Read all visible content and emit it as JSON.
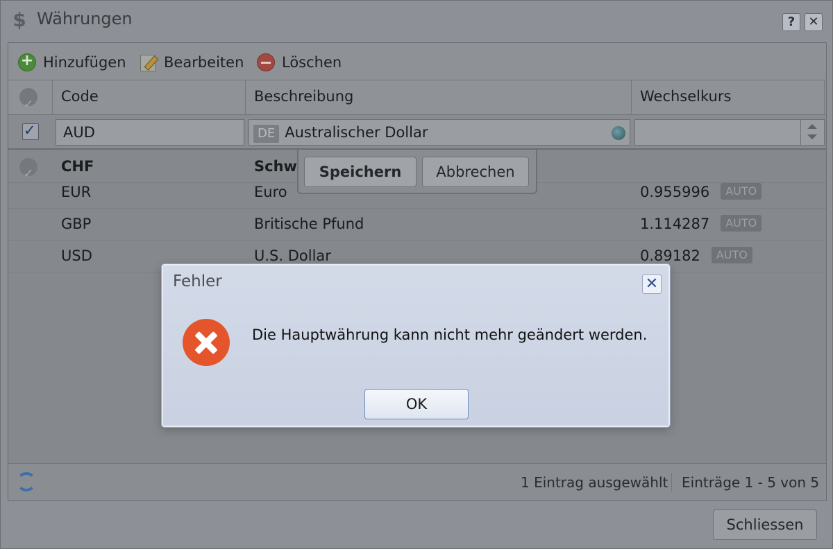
{
  "window": {
    "title": "Währungen",
    "help_label": "?",
    "close_label": "✕"
  },
  "toolbar": {
    "add_label": "Hinzufügen",
    "edit_label": "Bearbeiten",
    "delete_label": "Löschen"
  },
  "grid": {
    "columns": [
      "Code",
      "Beschreibung",
      "Wechselkurs"
    ],
    "edit_row": {
      "code": "AUD",
      "lang_badge": "DE",
      "description": "Australischer Dollar",
      "rate": ""
    },
    "rows": [
      {
        "code": "CHF",
        "description": "Schw",
        "rate": "",
        "auto": ""
      },
      {
        "code": "EUR",
        "description": "Euro",
        "rate": "0.955996",
        "auto": "AUTO"
      },
      {
        "code": "GBP",
        "description": "Britische Pfund",
        "rate": "1.114287",
        "auto": "AUTO"
      },
      {
        "code": "USD",
        "description": "U.S. Dollar",
        "rate": "0.89182",
        "auto": "AUTO"
      }
    ]
  },
  "row_editor": {
    "save_label": "Speichern",
    "cancel_label": "Abbrechen"
  },
  "footer": {
    "selection_text": "1 Eintrag ausgewählt",
    "range_text": "Einträge 1 - 5 von 5"
  },
  "close_button": "Schliessen",
  "dialog": {
    "title": "Fehler",
    "message": "Die Hauptwährung kann nicht mehr geändert werden.",
    "ok_label": "OK",
    "close_label": "✕"
  }
}
